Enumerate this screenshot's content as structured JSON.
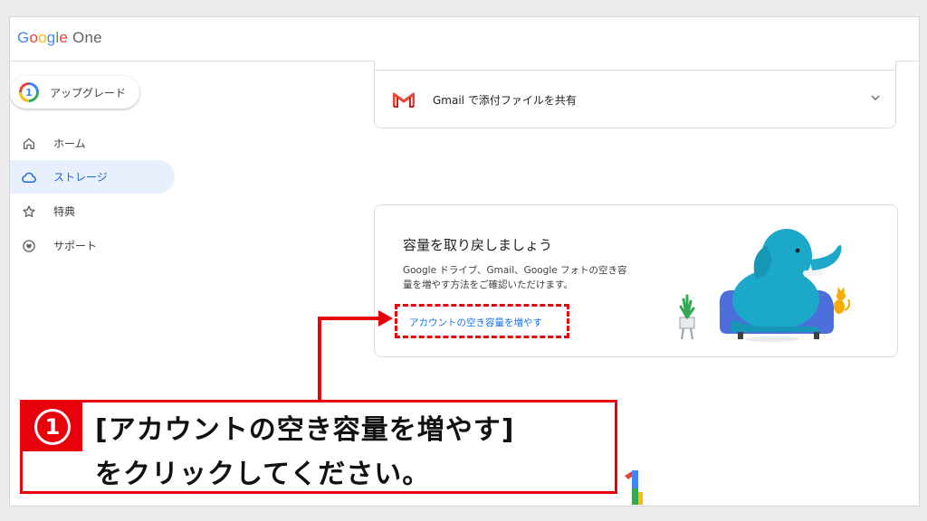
{
  "app": {
    "logo_google": [
      "G",
      "o",
      "o",
      "g",
      "l",
      "e"
    ],
    "logo_product": "One"
  },
  "sidebar": {
    "upgrade_label": "アップグレード",
    "upgrade_icon_digit": "1",
    "items": [
      {
        "label": "ホーム",
        "icon": "home-icon"
      },
      {
        "label": "ストレージ",
        "icon": "cloud-icon",
        "active": true
      },
      {
        "label": "特典",
        "icon": "star-icon"
      },
      {
        "label": "サポート",
        "icon": "support-icon"
      }
    ]
  },
  "gmail_card": {
    "label": "Gmail で添付ファイルを共有",
    "icon": "gmail-icon"
  },
  "storage_card": {
    "title": "容量を取り戻しましょう",
    "description": "Google ドライブ、Gmail、Google フォトの空き容量を増やす方法をご確認いただけます。",
    "link": "アカウントの空き容量を増やす"
  },
  "annotation": {
    "step_number": "1",
    "line1": "[アカウントの空き容量を増やす]",
    "line2": "をクリックしてください。"
  },
  "colors": {
    "accent_blue": "#1a73e8",
    "annotation_red": "#e8000b",
    "active_bg": "#e8f0fe"
  }
}
